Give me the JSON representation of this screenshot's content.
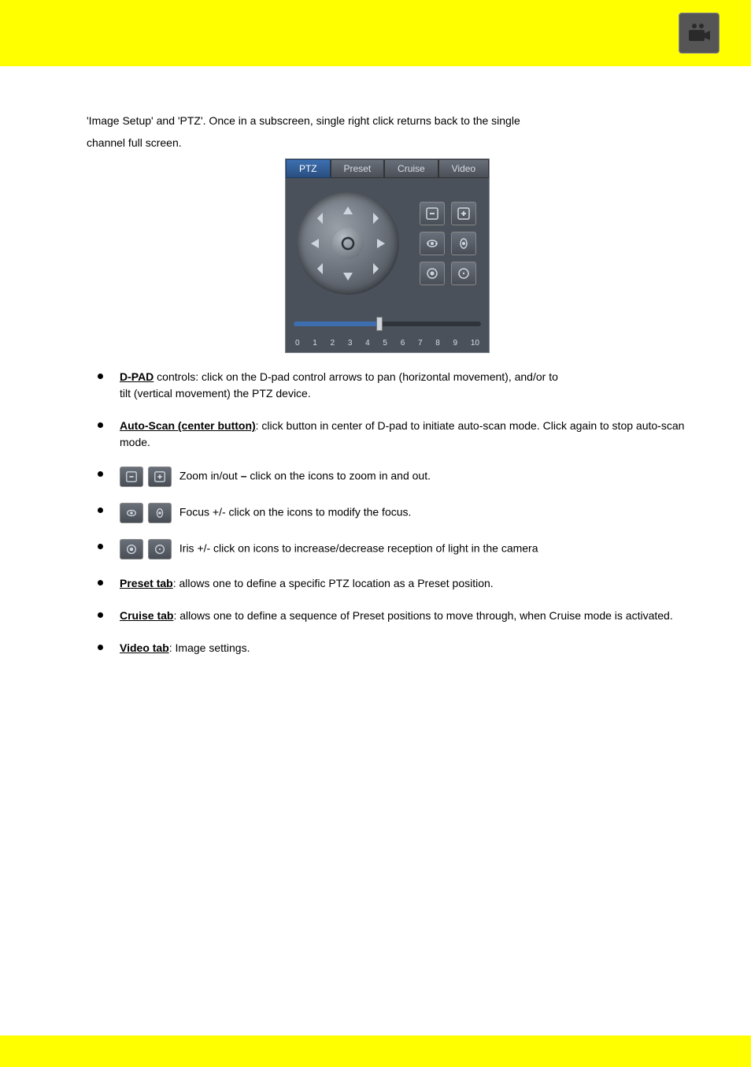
{
  "header": {
    "camera_icon": "camera-icon"
  },
  "intro": {
    "line1": "'Image Setup' and 'PTZ'. Once in a subscreen, single right click returns back to the single",
    "line2": "channel full screen."
  },
  "ptzPanel": {
    "tabs": {
      "ptz": "PTZ",
      "preset": "Preset",
      "cruise": "Cruise",
      "video": "Video"
    },
    "slider": {
      "ticks": [
        "0",
        "1",
        "2",
        "3",
        "4",
        "5",
        "6",
        "7",
        "8",
        "9",
        "10"
      ],
      "value": 5
    }
  },
  "bullets": {
    "dpad": {
      "head": "D-PAD",
      "body1": " controls: click on the D-pad control arrows to pan (horizontal movement), and/or to",
      "body2": "tilt (vertical movement) the PTZ device."
    },
    "autoscan": {
      "head": "Auto-Scan (center button)",
      "body": ": click button in center of D-pad to initiate auto-scan mode. Click again to stop auto-scan mode."
    },
    "zoom": {
      "label": "Zoom in/out ",
      "dash": "–",
      "body": " click on the icons to zoom in and out."
    },
    "focus": {
      "label": "Focus +/- click on the icons to modify the focus."
    },
    "iris": {
      "label": "Iris +/- click on icons to increase/decrease reception of light in the camera"
    },
    "preset": {
      "head": "Preset tab",
      "body": ": allows one to define a specific PTZ location as a Preset position."
    },
    "cruise": {
      "head": "Cruise tab",
      "body": ": allows one to define a sequence of Preset positions to move through, when Cruise mode is activated."
    },
    "video": {
      "head": "Video tab",
      "body": ": Image settings."
    }
  }
}
